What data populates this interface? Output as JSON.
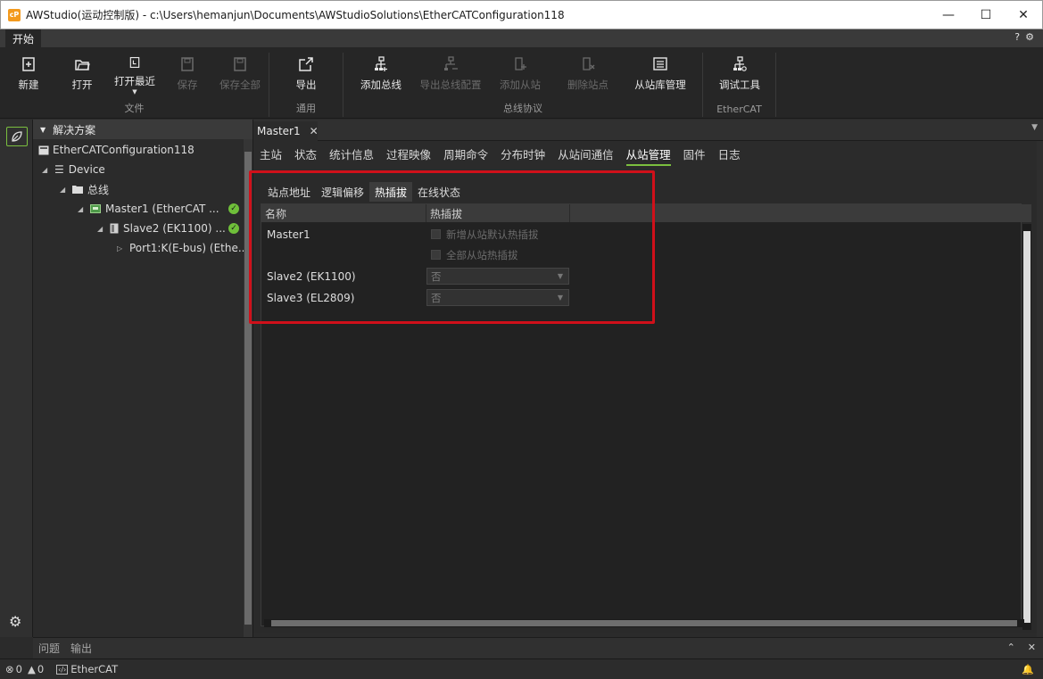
{
  "window": {
    "logo": "cP",
    "title": "AWStudio(运动控制版) - c:\\Users\\hemanjun\\Documents\\AWStudioSolutions\\EtherCATConfiguration118",
    "minimize": "—",
    "maximize": "☐",
    "close": "✕"
  },
  "ribbon_tab": "开始",
  "help_icons": [
    "?",
    "⚙"
  ],
  "ribbon": {
    "groups": [
      {
        "label": "文件",
        "buttons": [
          {
            "label": "新建",
            "icon": "new-file-icon",
            "enabled": true
          },
          {
            "label": "打开",
            "icon": "open-folder-icon",
            "enabled": true
          },
          {
            "label": "打开最近",
            "icon": "open-recent-icon",
            "enabled": true
          },
          {
            "label": "保存",
            "icon": "save-icon",
            "enabled": false
          },
          {
            "label": "保存全部",
            "icon": "save-all-icon",
            "enabled": false
          }
        ]
      },
      {
        "label": "通用",
        "buttons": [
          {
            "label": "导出",
            "icon": "export-icon",
            "enabled": true
          }
        ]
      },
      {
        "label": "总线协议",
        "buttons": [
          {
            "label": "添加总线",
            "icon": "add-bus-icon",
            "enabled": true
          },
          {
            "label": "导出总线配置",
            "icon": "export-bus-config-icon",
            "enabled": false
          },
          {
            "label": "添加从站",
            "icon": "add-slave-icon",
            "enabled": false
          },
          {
            "label": "删除站点",
            "icon": "delete-station-icon",
            "enabled": false
          },
          {
            "label": "从站库管理",
            "icon": "slave-library-icon",
            "enabled": true
          }
        ]
      },
      {
        "label": "EtherCAT",
        "buttons": [
          {
            "label": "调试工具",
            "icon": "debug-tool-icon",
            "enabled": true
          }
        ]
      }
    ]
  },
  "solution": {
    "header": "解决方案",
    "tree": [
      {
        "label": "EtherCATConfiguration118"
      },
      {
        "label": "Device"
      },
      {
        "label": "总线"
      },
      {
        "label": "Master1 (EtherCAT ..."
      },
      {
        "label": "Slave2 (EK1100) ..."
      },
      {
        "label": "Port1:K(E-bus) (Ethe..."
      }
    ]
  },
  "document": {
    "tab": "Master1",
    "subtabs": [
      "主站",
      "状态",
      "统计信息",
      "过程映像",
      "周期命令",
      "分布时钟",
      "从站间通信",
      "从站管理",
      "固件",
      "日志"
    ],
    "active_subtab": "从站管理",
    "inner_tabs": [
      "站点地址",
      "逻辑偏移",
      "热插拔",
      "在线状态"
    ],
    "active_inner_tab": "热插拔",
    "grid": {
      "columns": [
        "名称",
        "热插拔"
      ],
      "rows": [
        {
          "name": "Master1",
          "check_label": "新增从站默认热插拔"
        },
        {
          "name": "",
          "check_label": "全部从站热插拔"
        },
        {
          "name": "Slave2 (EK1100)",
          "select_value": "否"
        },
        {
          "name": "Slave3 (EL2809)",
          "select_value": "否"
        }
      ]
    }
  },
  "bottom_panel": {
    "tabs": [
      "问题",
      "输出"
    ]
  },
  "status_bar": {
    "errors": "0",
    "warnings": "0",
    "mode": "EtherCAT"
  },
  "colors": {
    "accent_green": "#7bbf3f",
    "highlight_red": "#d0101a",
    "ok_green": "#6fbf3a"
  }
}
